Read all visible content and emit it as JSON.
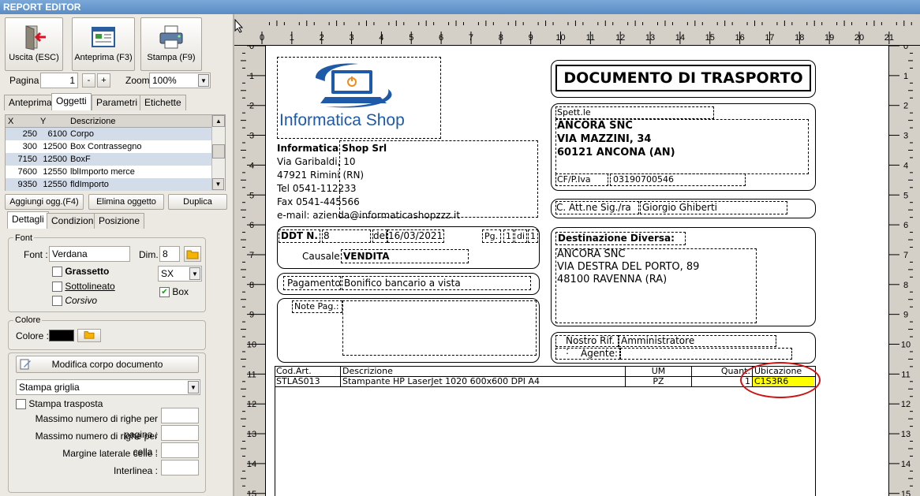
{
  "window": {
    "title": "REPORT EDITOR"
  },
  "toolbar": {
    "exit_label": "Uscita (ESC)",
    "preview_label": "Anteprima (F3)",
    "print_label": "Stampa (F9)",
    "page_label": "Pagina",
    "page_value": "1",
    "minus": "-",
    "plus": "+",
    "zoom_label": "Zoom",
    "zoom_value": "100%"
  },
  "tabs_top": [
    {
      "label": "Anteprima"
    },
    {
      "label": "Oggetti"
    },
    {
      "label": "Parametri"
    },
    {
      "label": "Etichette"
    }
  ],
  "objects_table": {
    "headers": [
      "X",
      "Y",
      "Descrizione"
    ],
    "rows": [
      {
        "x": "250",
        "y": "6100",
        "desc": "Corpo"
      },
      {
        "x": "300",
        "y": "12500",
        "desc": "Box Contrassegno"
      },
      {
        "x": "7150",
        "y": "12500",
        "desc": "BoxF"
      },
      {
        "x": "7600",
        "y": "12550",
        "desc": "lblImporto merce"
      },
      {
        "x": "9350",
        "y": "12550",
        "desc": "fldImporto"
      }
    ]
  },
  "object_buttons": {
    "add": "Aggiungi ogg.(F4)",
    "delete": "Elimina oggetto",
    "duplicate": "Duplica"
  },
  "tabs_detail": [
    {
      "label": "Dettagli"
    },
    {
      "label": "Condizioni"
    },
    {
      "label": "Posizione"
    }
  ],
  "font_group": {
    "title": "Font",
    "font_label": "Font :",
    "font_value": "Verdana",
    "size_label": "Dim.",
    "size_value": "8",
    "bold_label": "Grassetto",
    "underline_label": "Sottolineato",
    "italic_label": "Corsivo",
    "align_value": "SX",
    "box_label": "Box"
  },
  "color_group": {
    "title": "Colore",
    "label": "Colore :",
    "value": "#000000"
  },
  "body_group": {
    "edit_button": "Modifica corpo documento",
    "grid_select": "Stampa griglia",
    "transposed_label": "Stampa trasposta",
    "max_rows_page": "Massimo numero di righe per pagina :",
    "max_rows_cell": "Massimo numero di righe per cella :",
    "margin_cells": "Margine laterale celle :",
    "line_spacing": "Interlinea :"
  },
  "ruler": {
    "h": [
      "0",
      "1",
      "2",
      "3",
      "4",
      "5",
      "6",
      "7",
      "8",
      "9",
      "10",
      "11",
      "12",
      "13",
      "14",
      "15",
      "16",
      "17",
      "18",
      "19",
      "20",
      "21"
    ],
    "v": [
      "0",
      "1",
      "2",
      "3",
      "4",
      "5",
      "6",
      "7",
      "8",
      "9",
      "10",
      "11",
      "12",
      "13",
      "14",
      "15"
    ]
  },
  "report": {
    "logo_text": "Informatica Shop",
    "company": {
      "name": "Informatica Shop Srl",
      "address": "Via Garibaldi, 10",
      "city": "47921 Rimini (RN)",
      "tel": "Tel 0541-112233",
      "fax": "Fax 0541-445566",
      "email": "e-mail: azienda@informaticashopzzz.it"
    },
    "doc_title": "DOCUMENTO DI TRASPORTO",
    "recipient": {
      "label": "Spett.le",
      "name": "ANCORA SNC",
      "street": "VIA MAZZINI, 34",
      "city": "60121 ANCONA (AN)",
      "vat_label": "CF/P.Iva",
      "vat_value": "03190700546"
    },
    "attention": {
      "label": "C. Att.ne Sig./ra",
      "value": "Giorgio Ghiberti"
    },
    "ddt": {
      "num_label": "DDT N.",
      "num_value": "8",
      "date_label": "del",
      "date_value": "16/03/2021",
      "page_label": "Pg.",
      "page_value": "1",
      "of_label": "di",
      "of_value": "1",
      "reason_label": "Causale:",
      "reason_value": "VENDITA"
    },
    "payment": {
      "label": "Pagamento",
      "value": "Bonifico bancario a vista"
    },
    "notes_label": "Note Pag.:",
    "destination": {
      "title": "Destinazione Diversa:",
      "name": "ANCORA SNC",
      "street": "VIA DESTRA DEL PORTO, 89",
      "city": "48100 RAVENNA (RA)"
    },
    "reference": {
      "label": "Nostro Rif. :",
      "value": "Amministratore",
      "agent_label": "Agente:"
    },
    "table": {
      "headers": {
        "code": "Cod.Art.",
        "desc": "Descrizione",
        "um": "UM",
        "qty": "Quant.",
        "loc": "Ubicazione"
      },
      "row": {
        "code": "STLAS013",
        "desc": "Stampante HP LaserJet 1020 600x600 DPI A4",
        "um": "PZ",
        "qty": "1",
        "loc": "C1S3R6"
      }
    }
  },
  "colors": {
    "highlight": "#ffff00",
    "circle": "#cc1111",
    "titlebar": "#5a8cc4"
  }
}
